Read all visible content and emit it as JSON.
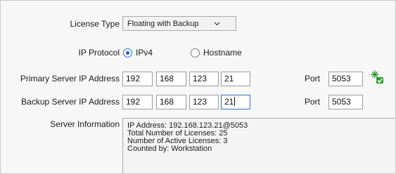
{
  "license_type": {
    "label": "License Type",
    "value": "Floating with Backup"
  },
  "ip_protocol": {
    "label": "IP Protocol",
    "options": [
      {
        "label": "IPv4",
        "selected": true
      },
      {
        "label": "Hostname",
        "selected": false
      }
    ]
  },
  "primary_server": {
    "label": "Primary Server IP Address",
    "octets": [
      "192",
      "168",
      "123",
      "21"
    ],
    "port_label": "Port",
    "port": "5053",
    "status_icon": "connection-ok-icon"
  },
  "backup_server": {
    "label": "Backup Server IP Address",
    "octets": [
      "192",
      "168",
      "123",
      "21"
    ],
    "port_label": "Port",
    "port": "5053"
  },
  "server_information": {
    "label": "Server Information",
    "lines": [
      "IP Address: 192.168.123.21@5053",
      "Total Number of Licenses: 25",
      "Number of Active Licenses: 3",
      "Counted by: Workstation"
    ]
  },
  "colors": {
    "panel_bg": "#f7f7f7",
    "accent": "#1f5fc9",
    "status_green": "#2e9b2e"
  }
}
